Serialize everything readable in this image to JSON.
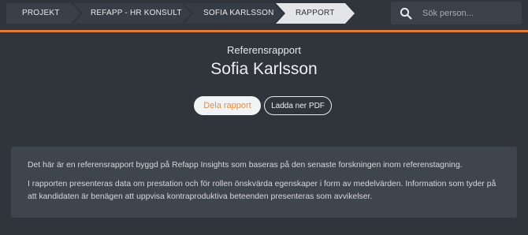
{
  "breadcrumb": [
    {
      "label": "PROJEKT"
    },
    {
      "label": "REFAPP - HR KONSULT"
    },
    {
      "label": "SOFIA KARLSSON"
    },
    {
      "label": "RAPPORT"
    }
  ],
  "search": {
    "placeholder": "Sök person...",
    "icon": "search-icon"
  },
  "report": {
    "subtitle": "Referensrapport",
    "candidate_name": "Sofia Karlsson"
  },
  "actions": {
    "share_label": "Dela rapport",
    "pdf_label": "Ladda ner PDF"
  },
  "info": {
    "paragraph1": "Det här är en referensrapport byggd på Refapp Insights som baseras på den senaste forskningen inom referenstagning.",
    "paragraph2": "I rapporten presenteras data om prestation och för rollen önskvärda egenskaper i form av medelvärden. Information som tyder på att kandidaten är benägen att uppvisa kontraproduktiva beteenden presenteras som avvikelser."
  },
  "colors": {
    "background": "#30353b",
    "accent": "#e07a3a",
    "active_crumb": "#e3e5e8"
  }
}
